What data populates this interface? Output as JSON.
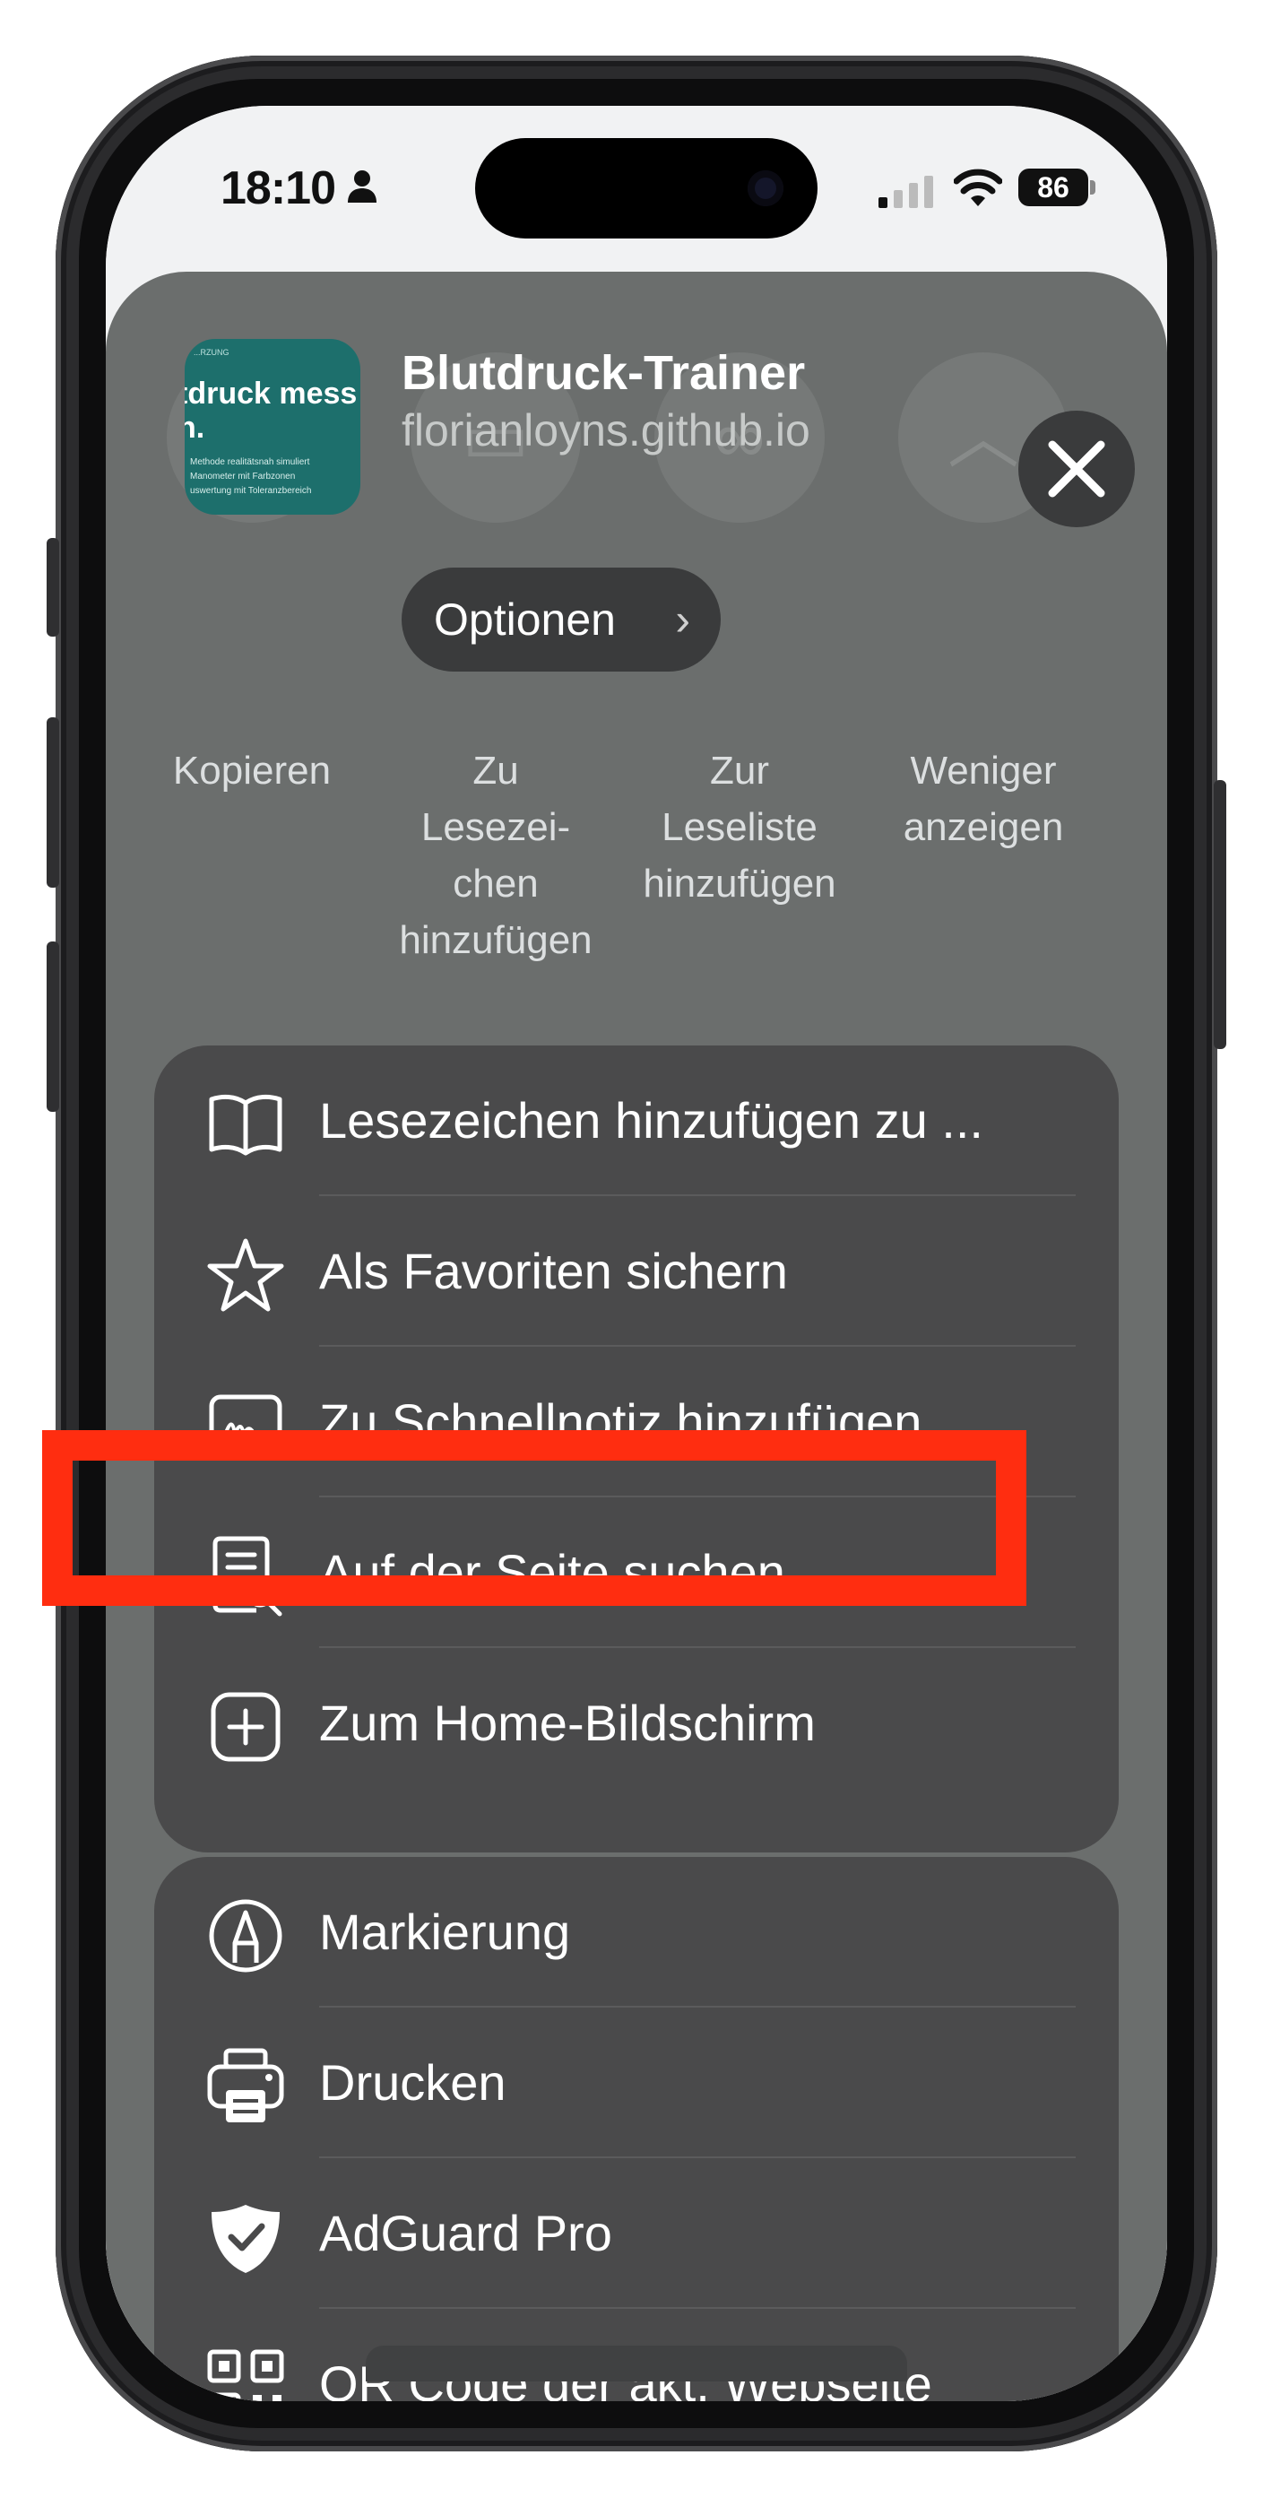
{
  "status_bar": {
    "time": "18:10",
    "battery": "86"
  },
  "share_sheet": {
    "app_thumbnail": {
      "small_text": "...RZUNG",
      "title": "tdruck mess\nn.",
      "lines": [
        "Methode realitätsnah simuliert",
        "Manometer mit Farbzonen",
        "uswertung mit Toleranzbereich"
      ]
    },
    "title": "Blutdruck-Trainer",
    "url": "florianloyns.github.io",
    "options_label": "Optionen",
    "background_actions": [
      {
        "label": "Kopieren",
        "icon": "copy-icon"
      },
      {
        "label": "Zu\nLesezei-\nchen\nhinzufügen",
        "icon": "book-icon"
      },
      {
        "label": "Zur\nLeseliste\nhinzufügen",
        "icon": "glasses-icon"
      },
      {
        "label": "Weniger\nanzeigen",
        "icon": "chevron-up-icon"
      }
    ],
    "group1": [
      {
        "label": "Lesezeichen hinzufügen zu ...",
        "icon": "book-icon"
      },
      {
        "label": "Als Favoriten sichern",
        "icon": "star-icon"
      },
      {
        "label": "Zu Schnellnotiz hinzufügen",
        "icon": "quick-note-icon"
      },
      {
        "label": "Auf der Seite suchen",
        "icon": "find-in-page-icon"
      },
      {
        "label": "Zum Home-Bildschirm",
        "icon": "add-square-icon"
      }
    ],
    "group2": [
      {
        "label": "Markierung",
        "icon": "markup-icon"
      },
      {
        "label": "Drucken",
        "icon": "printer-icon"
      },
      {
        "label": "AdGuard Pro",
        "icon": "shield-check-icon"
      },
      {
        "label": "QR Code der akt. Webseite",
        "icon": "qr-code-icon"
      }
    ]
  },
  "colors": {
    "highlight": "#ff2d10",
    "sheet_bg": "#6b6e6d",
    "group_bg": "#4a4a4b",
    "thumb_bg": "#1d6f6c"
  }
}
